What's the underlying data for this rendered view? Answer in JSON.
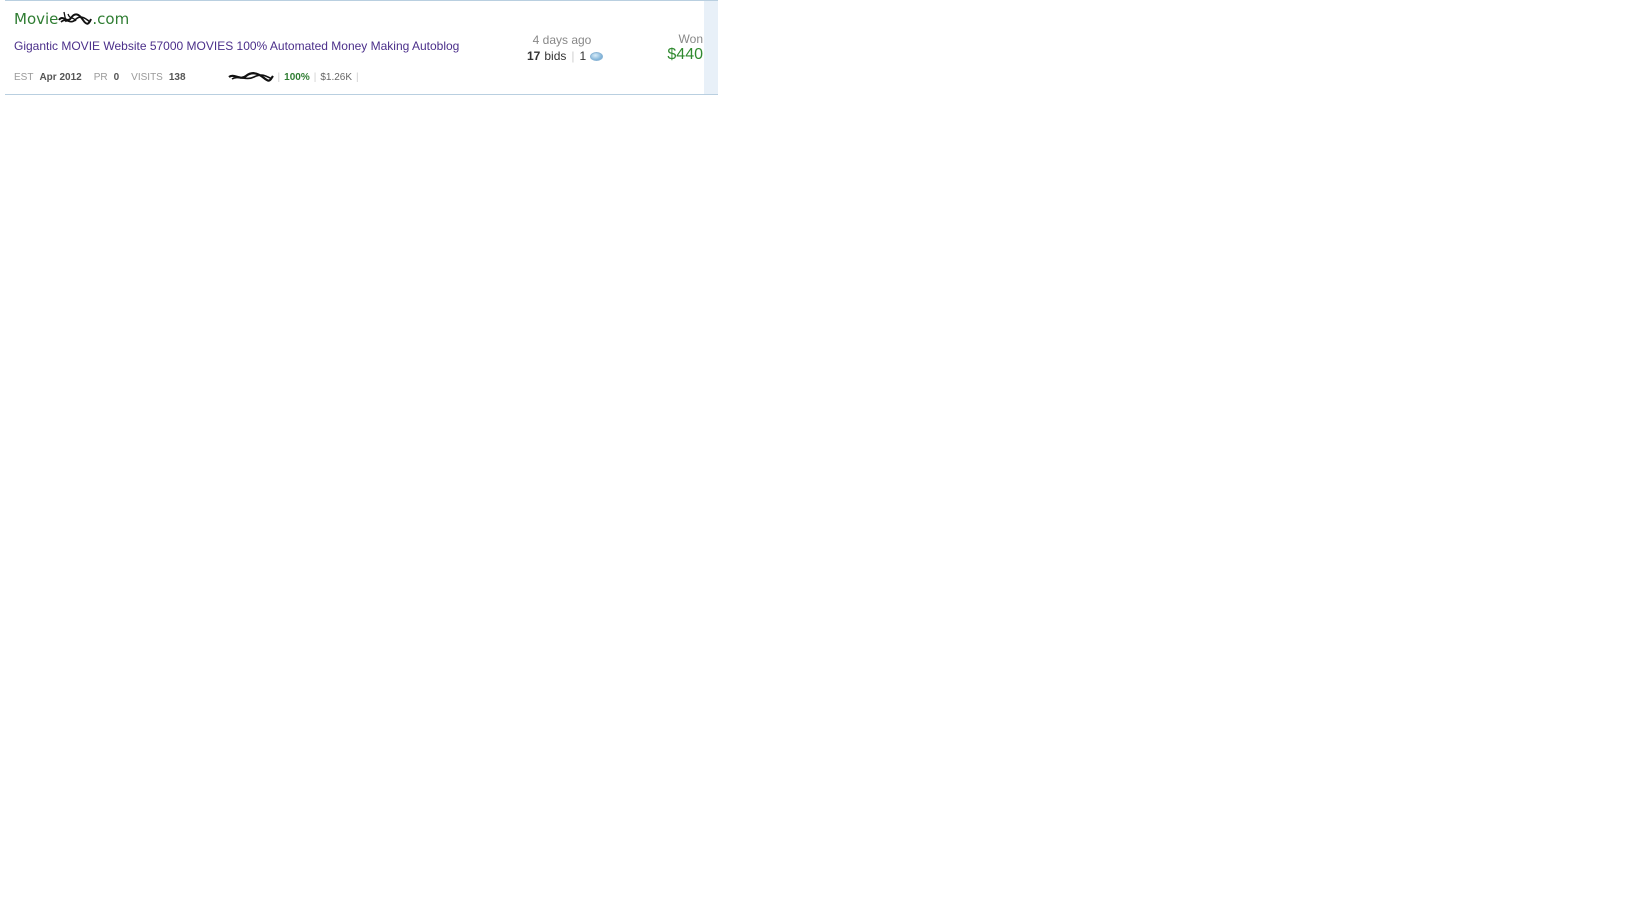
{
  "listing": {
    "domain_prefix": "Movie",
    "domain_suffix": ".com",
    "title": "Gigantic MOVIE Website 57000 MOVIES 100% Automated Money Making Autoblog",
    "est_label": "EST",
    "est_value": "Apr 2012",
    "pr_label": "PR",
    "pr_value": "0",
    "visits_label": "VISITS",
    "visits_value": "138",
    "seller_rating": "100%",
    "seller_sales": "$1.26K",
    "time_ago": "4 days ago",
    "bids_count": "17",
    "bids_label": "bids",
    "comments_count": "1",
    "status": "Won",
    "price": "$440"
  },
  "colors": {
    "domain": "#2f7d32",
    "title": "#4b2f8a",
    "price": "#2f8a2f",
    "border": "#b9cfe0"
  },
  "icons": [
    "comment-bubble-icon"
  ]
}
